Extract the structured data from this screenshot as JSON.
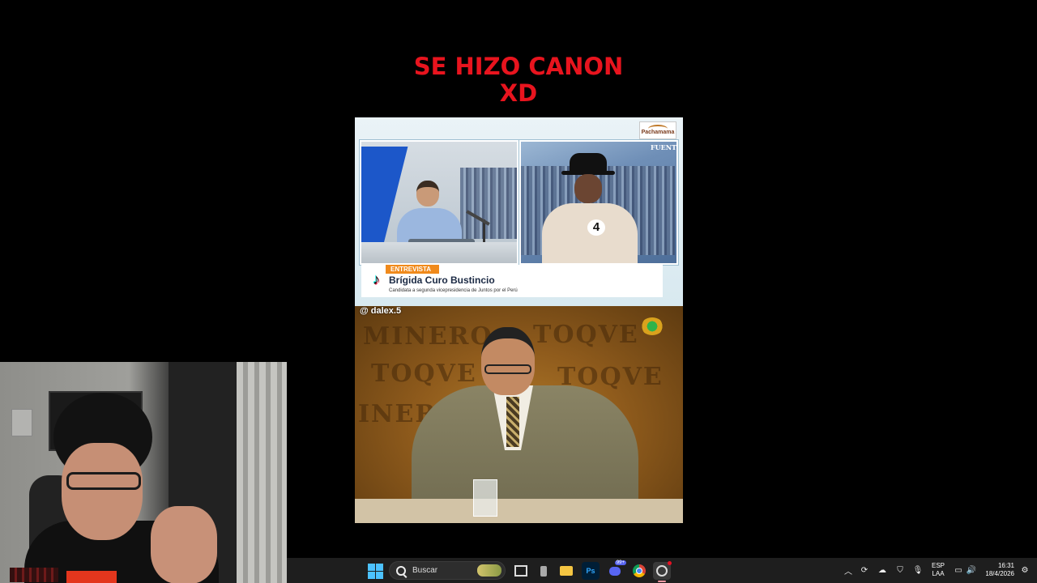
{
  "caption": {
    "line1": "SE HIZO CANON",
    "line2": "XD"
  },
  "video_top": {
    "channel_logo": "Pachamama",
    "source_label": "FUENT",
    "lower_third": {
      "tag": "ENTREVISTA",
      "name": "Brígida Curo Bustincio",
      "subtitle": "Candidata a segunda vicepresidencia de Juntos por el Perú"
    },
    "guest_number": "4"
  },
  "video_bottom": {
    "watermark": "@ dalex.5",
    "background_text": [
      "MINERO",
      "TOQVE",
      "TOQVE",
      "INERO",
      "TOQVE"
    ]
  },
  "taskbar": {
    "search_placeholder": "Buscar",
    "photoshop_label": "Ps",
    "discord_badge": "99+",
    "language_line1": "ESP",
    "language_line2": "LAA",
    "time": "16:31",
    "date": "18/4/2026"
  }
}
